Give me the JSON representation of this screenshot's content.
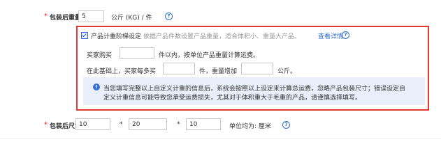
{
  "package_weight": {
    "required_mark": "*",
    "label": "包装后重量:",
    "value": "5",
    "unit": "公斤 (KG) / 件",
    "help_icon": "question-circle-icon"
  },
  "tiered_weight": {
    "checkbox_checked": true,
    "checkbox_label": "产品计重阶梯设定",
    "hint": "依据产品件数设置产品重量，适合体积小、重量大产品。",
    "detail_link": "查看详情",
    "help_icon": "question-circle-icon",
    "row1_prefix": "买家购买",
    "row1_value": "",
    "row1_suffix": "件以内，按单位产品重量计算运费。",
    "row2_prefix": "在此基础上，买家每多买",
    "row2_value": "",
    "row2_middle": "件，重量增加",
    "row2_value2": "",
    "row2_suffix": "公斤。",
    "notice_icon": "info-circle-icon",
    "notice_line1": "当您填写完整以上自定义计重的信息后，系统会按照以上设定来计算总运费，忽略产品包装尺寸；错误设定自",
    "notice_line2": "定义计重信息可能导致您承受运费损失，尤其对于体积重大于毛重的产品，请谨慎选择填写。",
    "accent_color": "#e53935"
  },
  "package_size": {
    "required_mark": "*",
    "label": "包装后尺寸:",
    "length": "10",
    "times1": "*",
    "width": "20",
    "times2": "*",
    "height": "10",
    "unit": "单位均为: 厘米",
    "help_icon": "question-circle-icon"
  }
}
